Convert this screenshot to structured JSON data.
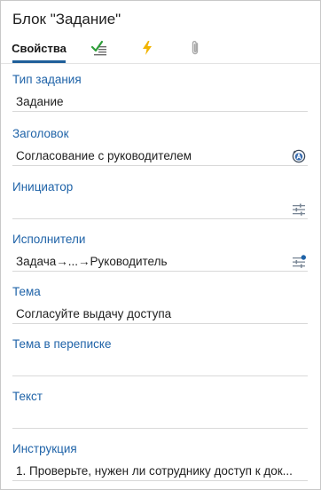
{
  "window": {
    "title": "Блок \"Задание\""
  },
  "tabs": [
    {
      "label": "Свойства",
      "active": true
    },
    {
      "icon": "checklist-icon"
    },
    {
      "icon": "lightning-icon"
    },
    {
      "icon": "paperclip-icon"
    }
  ],
  "fields": {
    "task_type": {
      "label": "Тип задания",
      "value": "Задание"
    },
    "subject": {
      "label": "Заголовок",
      "value": "Согласование с руководителем",
      "icon": "auto-expression-icon"
    },
    "initiator": {
      "label": "Инициатор",
      "value": "",
      "icon": "settings-sliders-icon"
    },
    "performers": {
      "label": "Исполнители",
      "value": "Задача→...→Руководитель",
      "icon": "settings-sliders-dot-icon"
    },
    "topic": {
      "label": "Тема",
      "value": "Согласуйте выдачу доступа"
    },
    "thread_topic": {
      "label": "Тема в переписке",
      "value": ""
    },
    "text": {
      "label": "Текст",
      "value": ""
    },
    "instruction": {
      "label": "Инструкция",
      "value": "1. Проверьте, нужен ли сотруднику доступ к док..."
    }
  },
  "colors": {
    "label": "#1f63a8",
    "tab_underline": "#1f5f9a",
    "lightning": "#f2b400",
    "check_green": "#2e9e3a"
  }
}
